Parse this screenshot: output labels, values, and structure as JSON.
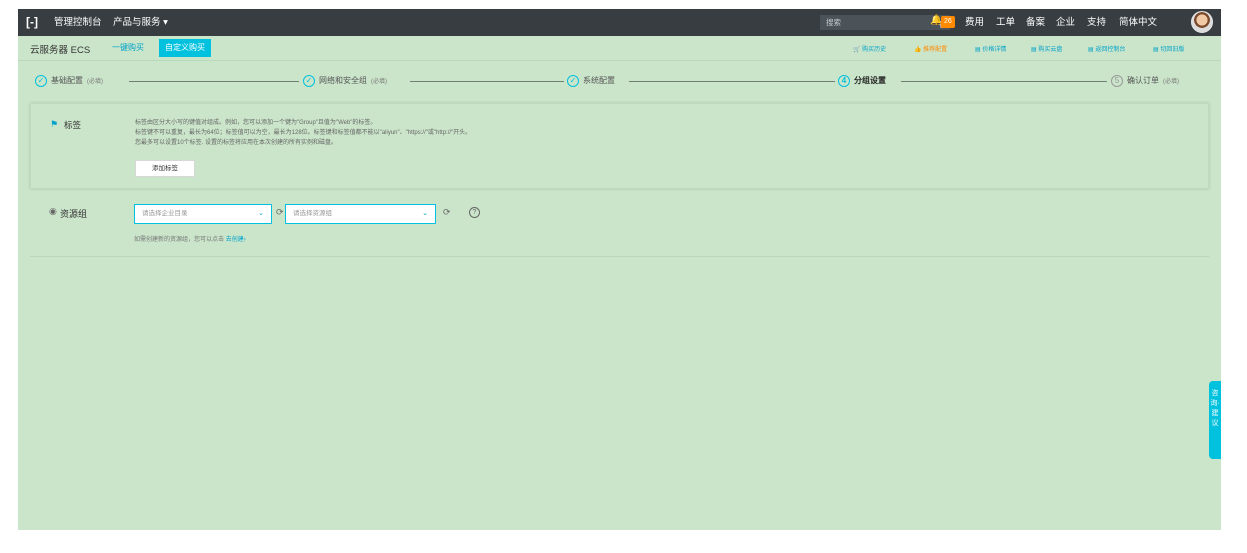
{
  "topbar": {
    "logo": "[-]",
    "console": "管理控制台",
    "products": "产品与服务 ▾",
    "search_placeholder": "搜索",
    "badge": "26",
    "menu": [
      "费用",
      "工单",
      "备案",
      "企业",
      "支持",
      "简体中文"
    ]
  },
  "subbar": {
    "product": "云服务器 ECS",
    "tab_quick": "一键购买",
    "tab_custom": "自定义购买",
    "links": [
      "购买历史",
      "推荐配置",
      "价格详情",
      "购买云盘",
      "返回控制台",
      "切回旧版"
    ]
  },
  "steps": [
    {
      "label": "基础配置",
      "req": "(必填)",
      "mark": "✓"
    },
    {
      "label": "网络和安全组",
      "req": "(必填)",
      "mark": "✓"
    },
    {
      "label": "系统配置",
      "req": "",
      "mark": "✓"
    },
    {
      "label": "分组设置",
      "req": "",
      "mark": "4"
    },
    {
      "label": "确认订单",
      "req": "(必填)",
      "mark": "5"
    }
  ],
  "tag": {
    "label": "标签",
    "desc": [
      "标签由区分大小写的键值对组成。例如，您可以添加一个键为\"Group\"且值为\"Web\"的标签。",
      "标签键不可以重复，最长为64位；标签值可以为空，最长为128位。标签键和标签值都不能以\"aliyun\"、\"https://\"或\"http://\"开头。",
      "您最多可以设置10个标签. 设置的标签将应用在本次创建的所有实例和磁盘。"
    ],
    "add_button": "添加标签"
  },
  "resource_group": {
    "label": "资源组",
    "enterprise_placeholder": "请选择企业目录",
    "group_placeholder": "请选择资源组",
    "hint": "如需创建新的资源组，您可以点击",
    "hint_link": "去创建›"
  },
  "float_button": "咨询·建议"
}
